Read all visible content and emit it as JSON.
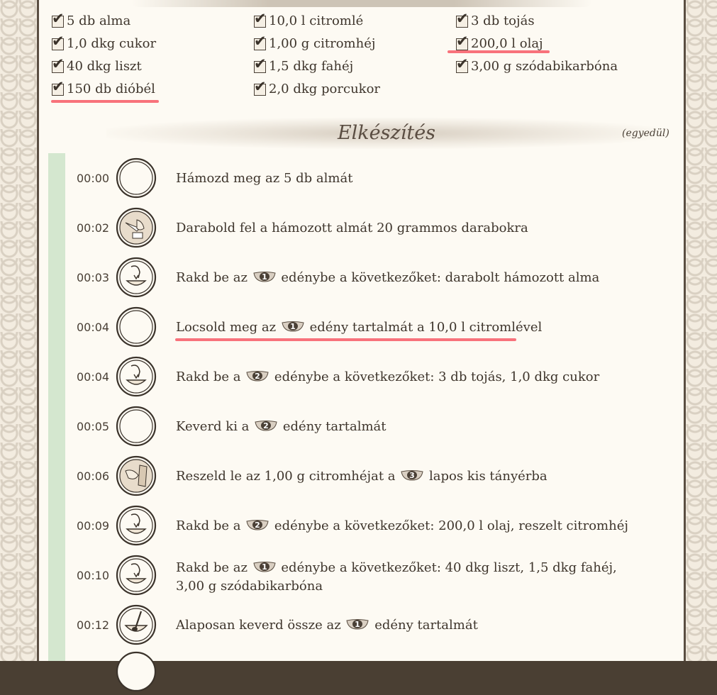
{
  "ingredients": {
    "col1": [
      "5 db alma",
      "1,0 dkg cukor",
      "40 dkg liszt",
      "150 db dióbél"
    ],
    "col2": [
      "10,0 l citromlé",
      "1,00 g citromhéj",
      "1,5 dkg fahéj",
      "2,0 dkg porcukor"
    ],
    "col3": [
      "3 db tojás",
      "200,0 l olaj",
      "3,00 g szódabikarbóna"
    ]
  },
  "section": {
    "title": "Elkészítés",
    "single_label": "(egyedül)"
  },
  "steps": [
    {
      "time": "00:00",
      "icon": "empty-circle-icon",
      "parts": [
        "Hámozd meg az 5 db almát"
      ]
    },
    {
      "time": "00:02",
      "icon": "cutting-icon",
      "parts": [
        "Darabold fel a hámozott almát 20 grammos darabokra"
      ]
    },
    {
      "time": "00:03",
      "icon": "put-in-bowl-icon",
      "parts": [
        "Rakd be az ",
        " edénybe a következőket: darabolt hámozott alma"
      ],
      "bowl": "1"
    },
    {
      "time": "00:04",
      "icon": "empty-circle-icon",
      "parts": [
        "Locsold meg az ",
        " edény tartalmát a 10,0 l citromlével"
      ],
      "bowl": "1"
    },
    {
      "time": "00:04",
      "icon": "put-in-bowl-icon",
      "parts": [
        "Rakd be a ",
        " edénybe a következőket: 3 db tojás, 1,0 dkg cukor"
      ],
      "bowl": "2"
    },
    {
      "time": "00:05",
      "icon": "empty-circle-icon",
      "parts": [
        "Keverd ki a ",
        " edény tartalmát"
      ],
      "bowl": "2"
    },
    {
      "time": "00:06",
      "icon": "grating-icon",
      "parts": [
        "Reszeld le az 1,00 g citromhéjat a ",
        " lapos kis tányérba"
      ],
      "bowl": "3"
    },
    {
      "time": "00:09",
      "icon": "put-in-bowl-icon",
      "parts": [
        "Rakd be a ",
        " edénybe a következőket: 200,0 l olaj, reszelt citromhéj"
      ],
      "bowl": "2"
    },
    {
      "time": "00:10",
      "icon": "put-in-bowl-icon",
      "parts": [
        "Rakd be az ",
        " edénybe a következőket: 40 dkg liszt, 1,5 dkg fahéj, 3,00 g szódabikarbóna"
      ],
      "bowl": "1"
    },
    {
      "time": "00:12",
      "icon": "mixing-icon",
      "parts": [
        "Alaposan keverd össze az ",
        " edény tartalmát"
      ],
      "bowl": "1"
    }
  ],
  "colors": {
    "highlight": "#f7636e",
    "progress_bar": "#d4e7cf",
    "background": "#fdfaf3"
  }
}
